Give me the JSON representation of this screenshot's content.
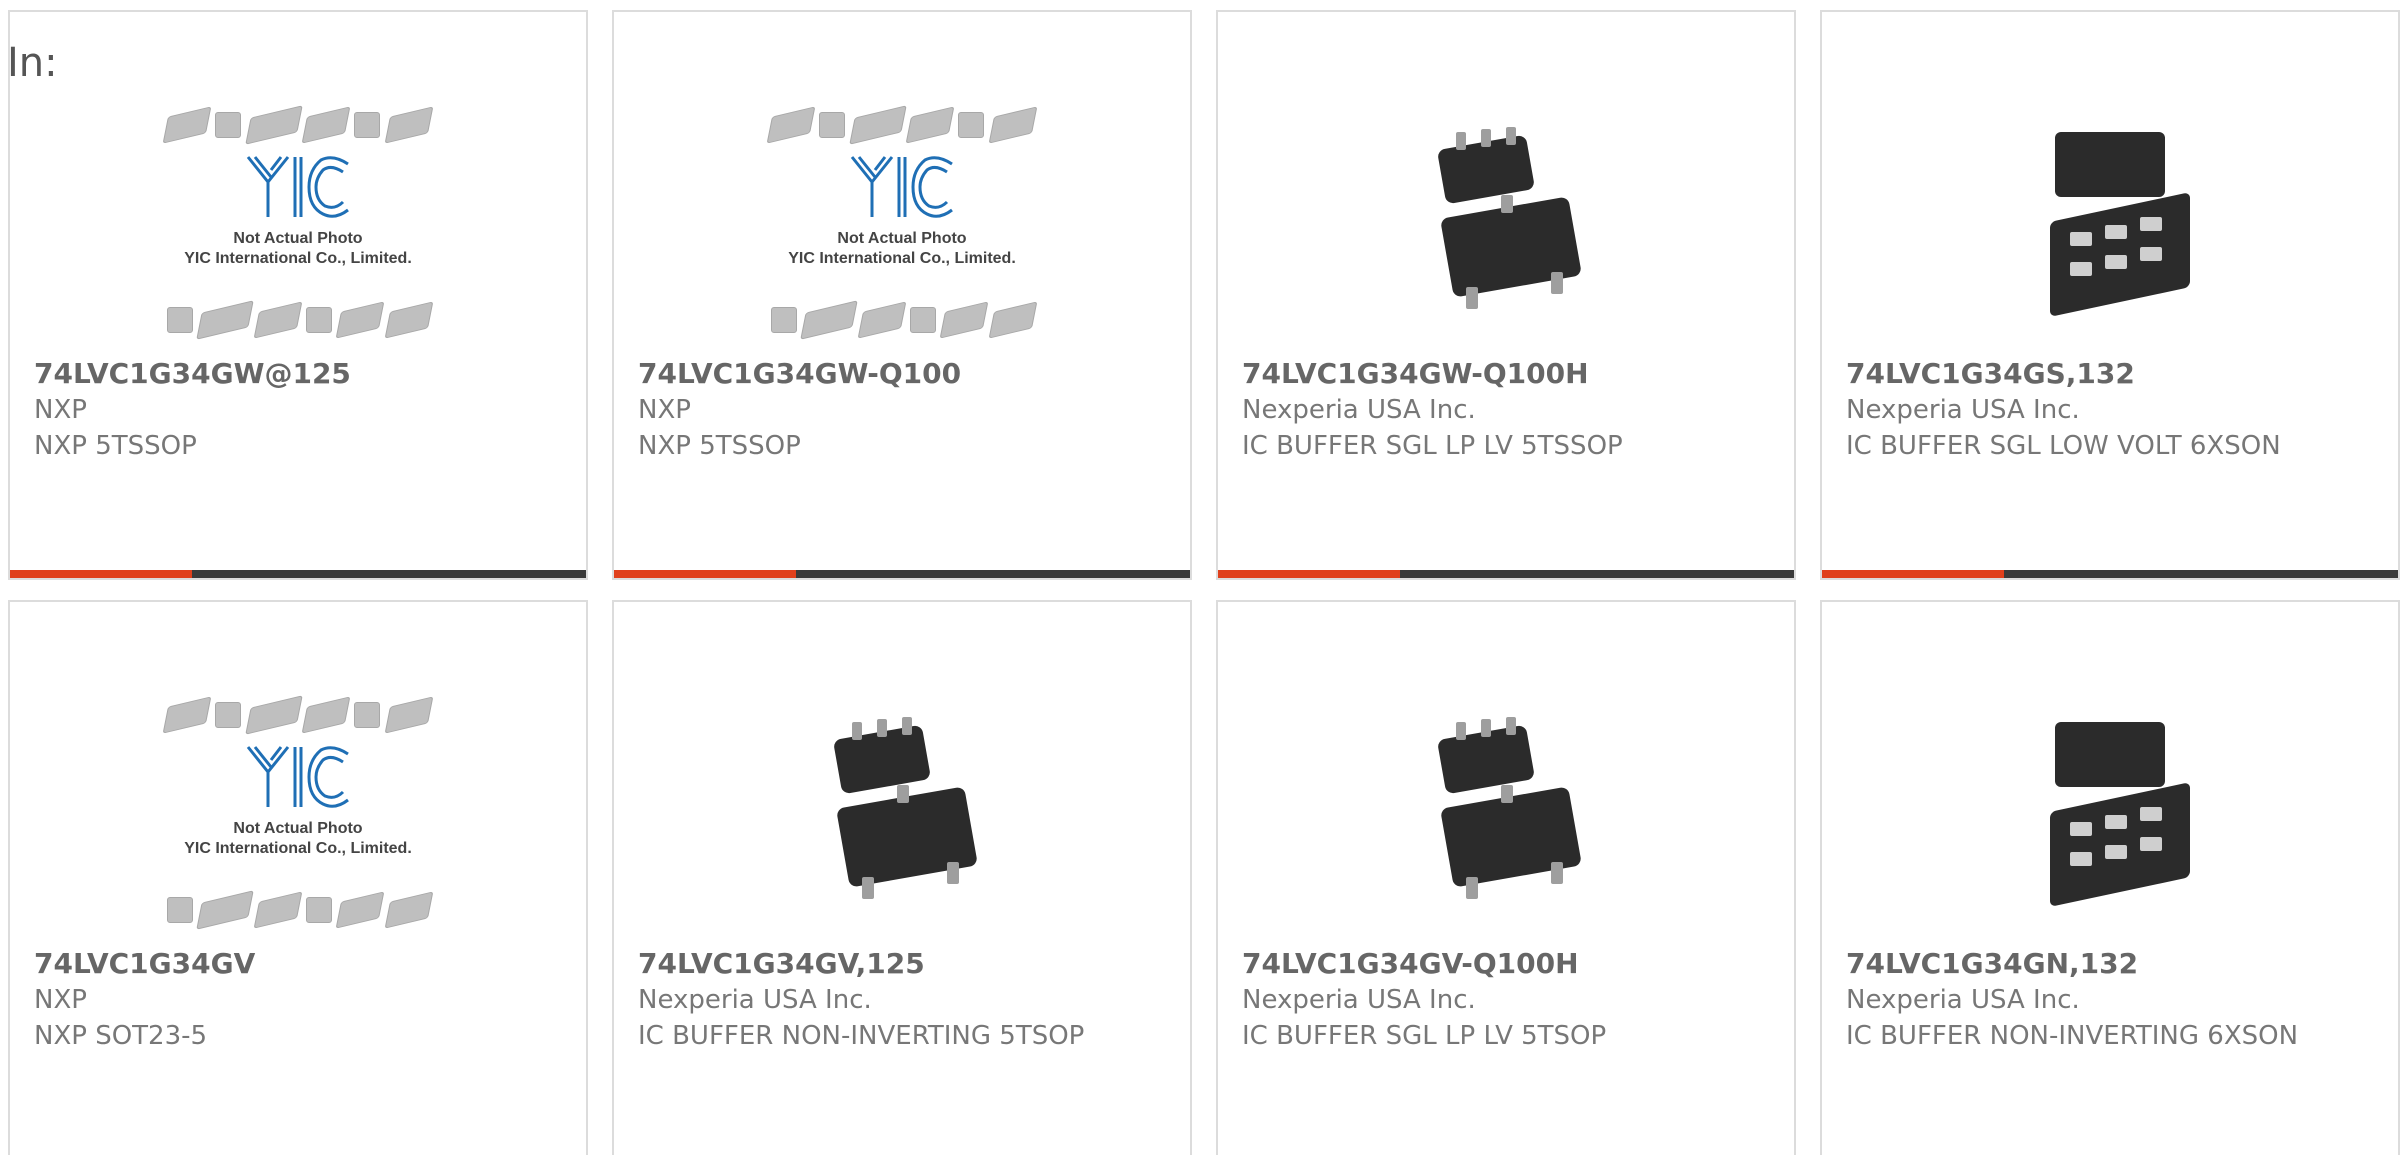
{
  "filter_label": "In:",
  "products": [
    {
      "part": "74LVC1G34GW@125",
      "manufacturer": "NXP",
      "description": "NXP 5TSSOP",
      "image": "yic-placeholder"
    },
    {
      "part": "74LVC1G34GW-Q100",
      "manufacturer": "NXP",
      "description": "NXP 5TSSOP",
      "image": "yic-placeholder"
    },
    {
      "part": "74LVC1G34GW-Q100H",
      "manufacturer": "Nexperia USA Inc.",
      "description": "IC BUFFER SGL LP LV 5TSSOP",
      "image": "sot-package"
    },
    {
      "part": "74LVC1G34GS,132",
      "manufacturer": "Nexperia USA Inc.",
      "description": "IC BUFFER SGL LOW VOLT 6XSON",
      "image": "xson-package"
    },
    {
      "part": "74LVC1G34GV",
      "manufacturer": "NXP",
      "description": "NXP SOT23-5",
      "image": "yic-placeholder"
    },
    {
      "part": "74LVC1G34GV,125",
      "manufacturer": "Nexperia USA Inc.",
      "description": "IC BUFFER NON-INVERTING 5TSOP",
      "image": "sot-package"
    },
    {
      "part": "74LVC1G34GV-Q100H",
      "manufacturer": "Nexperia USA Inc.",
      "description": "IC BUFFER SGL LP LV 5TSOP",
      "image": "sot-package"
    },
    {
      "part": "74LVC1G34GN,132",
      "manufacturer": "Nexperia USA Inc.",
      "description": "IC BUFFER NON-INVERTING 6XSON",
      "image": "xson-package"
    }
  ],
  "placeholder": {
    "line1": "Not Actual Photo",
    "line2": "YIC International Co., Limited.",
    "logo": "YIC"
  },
  "colors": {
    "accent": "#e0401c",
    "bar": "#3a3a3a",
    "logo": "#1f6fb5"
  }
}
